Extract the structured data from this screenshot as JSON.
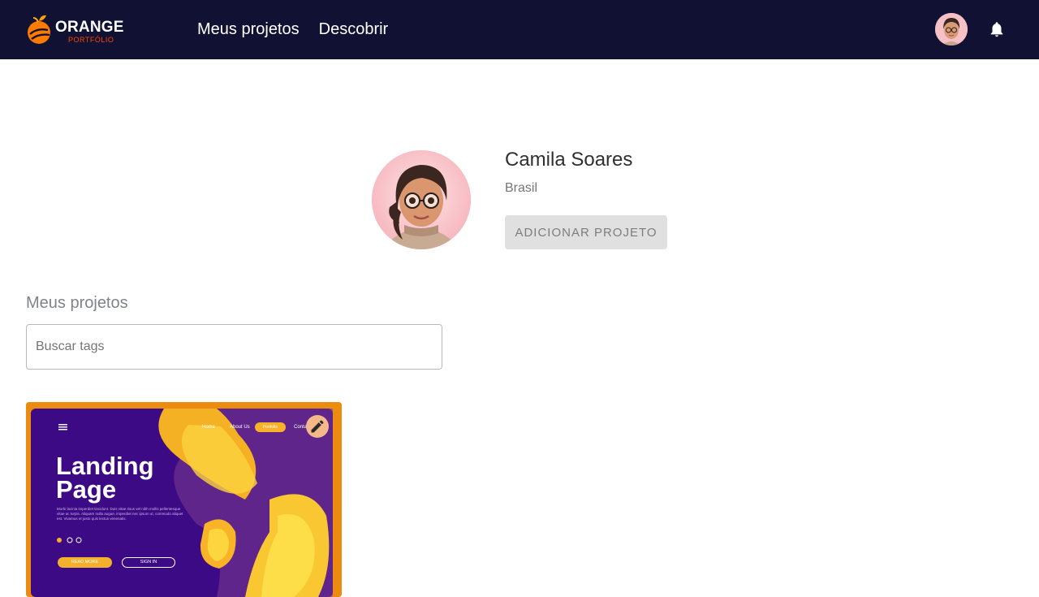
{
  "header": {
    "logo": {
      "brand": "ORANGE",
      "sub": "PORTFÓLIO"
    },
    "nav": [
      {
        "label": "Meus projetos"
      },
      {
        "label": "Descobrir"
      }
    ]
  },
  "profile": {
    "name": "Camila Soares",
    "country": "Brasil",
    "add_project_label": "ADICIONAR PROJETO"
  },
  "projects": {
    "title": "Meus projetos",
    "search": {
      "placeholder": "Buscar tags",
      "value": ""
    },
    "cards": [
      {
        "title": "Landing Page",
        "nav_items": [
          "Home",
          "About Us",
          "Portfolio",
          "Conta"
        ],
        "lorem": "Morbi lacinia imperdiet tincidunt. Duis vitae risus vel nibh mollis pellentesque vitae ac turpis. Aliquam nulla augue, imperdiet nec ipsum ut, commodo aliquet est. Vivamus et justo quis lectus venenatis.",
        "primary_button": "READ MORE",
        "secondary_button": "SIGN IN"
      }
    ]
  },
  "colors": {
    "header_bg": "#111133",
    "accent": "#FE4400",
    "button_disabled_bg": "#e0e0e0",
    "card_bg": "#ea8a12"
  },
  "icons": [
    "orange-logo-icon",
    "bell-icon",
    "edit-pencil-icon",
    "hamburger-icon"
  ]
}
